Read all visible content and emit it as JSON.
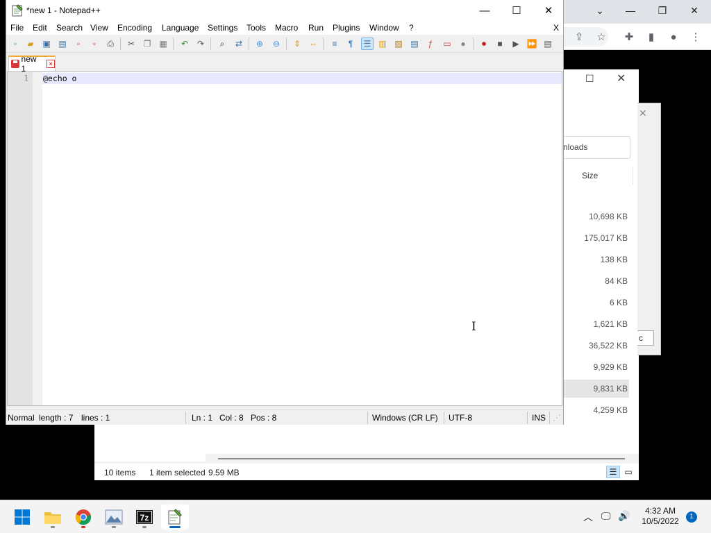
{
  "notepad": {
    "title": "*new 1 - Notepad++",
    "menus": [
      "File",
      "Edit",
      "Search",
      "View",
      "Encoding",
      "Language",
      "Settings",
      "Tools",
      "Macro",
      "Run",
      "Plugins",
      "Window",
      "?"
    ],
    "menu_close": "X",
    "tab_label": "new 1",
    "line_number": "1",
    "code_text": "@echo o",
    "status": {
      "mode": "Normal",
      "length": "length : 7",
      "lines": "lines : 1",
      "ln": "Ln : 1",
      "col": "Col : 8",
      "pos": "Pos : 8",
      "eol": "Windows (CR LF)",
      "encoding": "UTF-8",
      "ins": "INS"
    }
  },
  "explorer": {
    "search_text": "nloads",
    "size_header": "Size",
    "sizes": [
      "10,698 KB",
      "175,017 KB",
      "138 KB",
      "84 KB",
      "6 KB",
      "1,621 KB",
      "36,522 KB",
      "9,929 KB",
      "9,831 KB",
      "4,259 KB"
    ],
    "selected_index": 8,
    "status_items": "10 items",
    "status_selected": "1 item selected",
    "status_size": "9.59 MB"
  },
  "dialog": {
    "button_fragment": "c"
  },
  "taskbar": {
    "time": "4:32 AM",
    "date": "10/5/2022",
    "notification_count": "1",
    "apps": [
      "start-icon",
      "file-explorer-icon",
      "chrome-icon",
      "photo-viewer-icon",
      "7zip-icon",
      "notepadpp-icon"
    ]
  },
  "colors": {
    "tab_accent": "#f0a830",
    "current_line": "#e8e8ff",
    "taskbar_accent": "#0067c0",
    "save_red": "#d9383a"
  }
}
